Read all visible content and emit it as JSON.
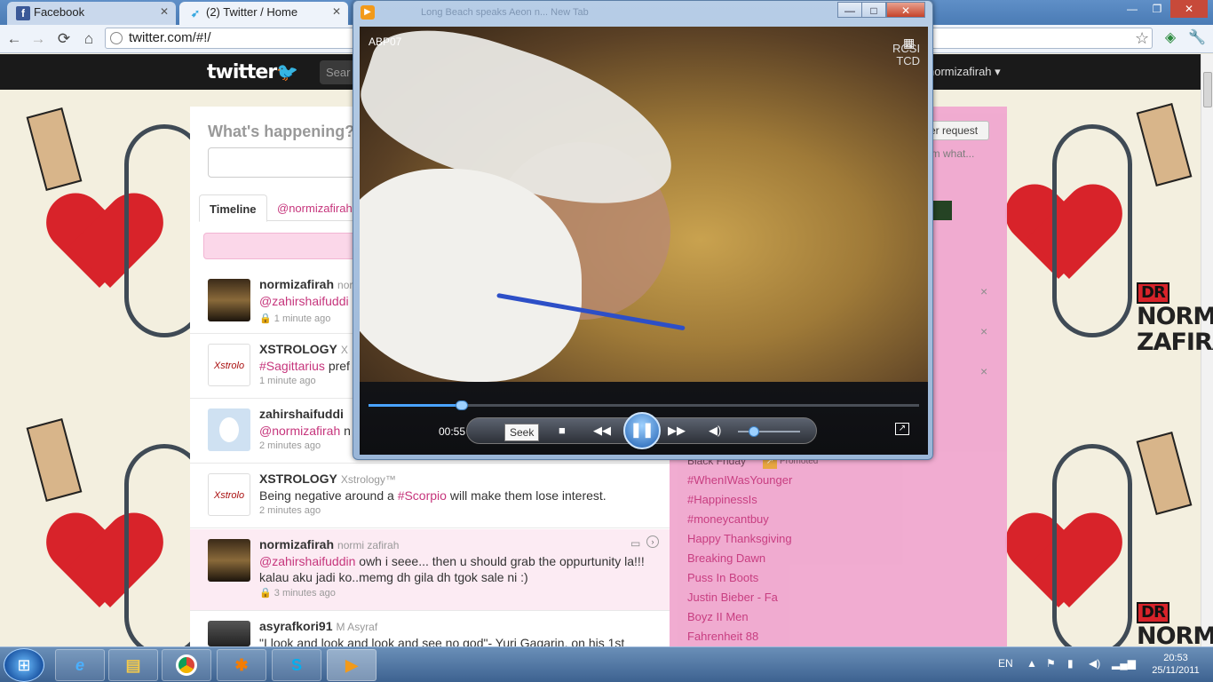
{
  "browser": {
    "tabs": [
      {
        "label": "Facebook",
        "icon": "facebook-icon"
      },
      {
        "label": "(2) Twitter / Home",
        "icon": "twitter-bird-icon"
      }
    ],
    "address": "twitter.com/#!/"
  },
  "twitter": {
    "logo": "twitter",
    "search_placeholder": "Sear",
    "username": "normizafirah ▾",
    "compose_prompt": "What's happening?",
    "tabs": {
      "timeline": "Timeline",
      "mentions": "@normizafirah"
    },
    "tweets": [
      {
        "user": "normizafirah",
        "fullname": "nor",
        "text_link": "@zahirshaifuddi",
        "text": "",
        "time": "1 minute ago",
        "locked": true
      },
      {
        "user": "XSTROLOGY",
        "fullname": "X",
        "text_link": "#Sagittarius",
        "text": " pref",
        "time": "1 minute ago",
        "locked": false
      },
      {
        "user": "zahirshaifuddi",
        "fullname": "",
        "text_link": "@normizafirah",
        "text": " n",
        "time": "2 minutes ago",
        "locked": true
      },
      {
        "user": "XSTROLOGY",
        "fullname": "Xstrology™",
        "text_pre": "Being negative around a ",
        "text_link": "#Scorpio",
        "text": " will make them lose interest.",
        "time": "2 minutes ago",
        "locked": false
      },
      {
        "user": "normizafirah",
        "fullname": "normi zafirah",
        "text_link": "@zahirshaifuddin",
        "text": " owh i seee... then u should grab the oppurtunity la!!! kalau aku jadi ko..memg dh gila dh tgok sale ni :)",
        "time": "3 minutes ago",
        "locked": true
      },
      {
        "user": "asyrafkori91",
        "fullname": "M Asyraf",
        "text_link": "",
        "text": "\"I look and look and look and see no god\"- Yuri Gagarin, on his 1st",
        "time": "",
        "locked": false
      }
    ],
    "sidebar": {
      "follow_request": "er request",
      "who_text": "om what...",
      "black_friday": "Black Friday",
      "promoted": "Promoted",
      "trends": [
        "#WhenIWasYounger",
        "#HappinessIs",
        "#moneycantbuy",
        "Happy Thanksgiving",
        "Breaking Dawn",
        "Puss In Boots",
        "Justin Bieber - Fa",
        "Boyz II Men",
        "Fahrenheit 88"
      ],
      "dismiss": "×"
    }
  },
  "background": {
    "brand_top": "DR",
    "brand_line1": "NORMI",
    "brand_line2": "ZAFIRA",
    "brand_bottom": "NORM"
  },
  "media_player": {
    "window_controls": {
      "minimize": "—",
      "maximize": "□",
      "close": "✕"
    },
    "ghost_title": "Long Beach speaks Aeon n...          New Tab",
    "video_label": "ABP07",
    "watermark_line1": "RCSI",
    "watermark_line2": "TCD",
    "time": "00:55",
    "seek_progress": 0.17,
    "volume_level": 0.25,
    "tooltip": "Seek",
    "buttons": {
      "stop": "■",
      "prev": "◀◀",
      "play_pause": "❚❚",
      "next": "▶▶",
      "mute": "◀)",
      "fullscreen": "↗"
    }
  },
  "taskbar": {
    "language": "EN",
    "time": "20:53",
    "date": "25/11/2011",
    "apps": [
      "internet-explorer-icon",
      "file-explorer-icon",
      "chrome-icon",
      "feed-app-icon",
      "skype-icon",
      "media-player-icon"
    ]
  },
  "colors": {
    "accent": "#c6357c",
    "sidebar": "#f0a8d0",
    "twitter_bar": "#1a1a1a",
    "heart": "#d8232a"
  }
}
